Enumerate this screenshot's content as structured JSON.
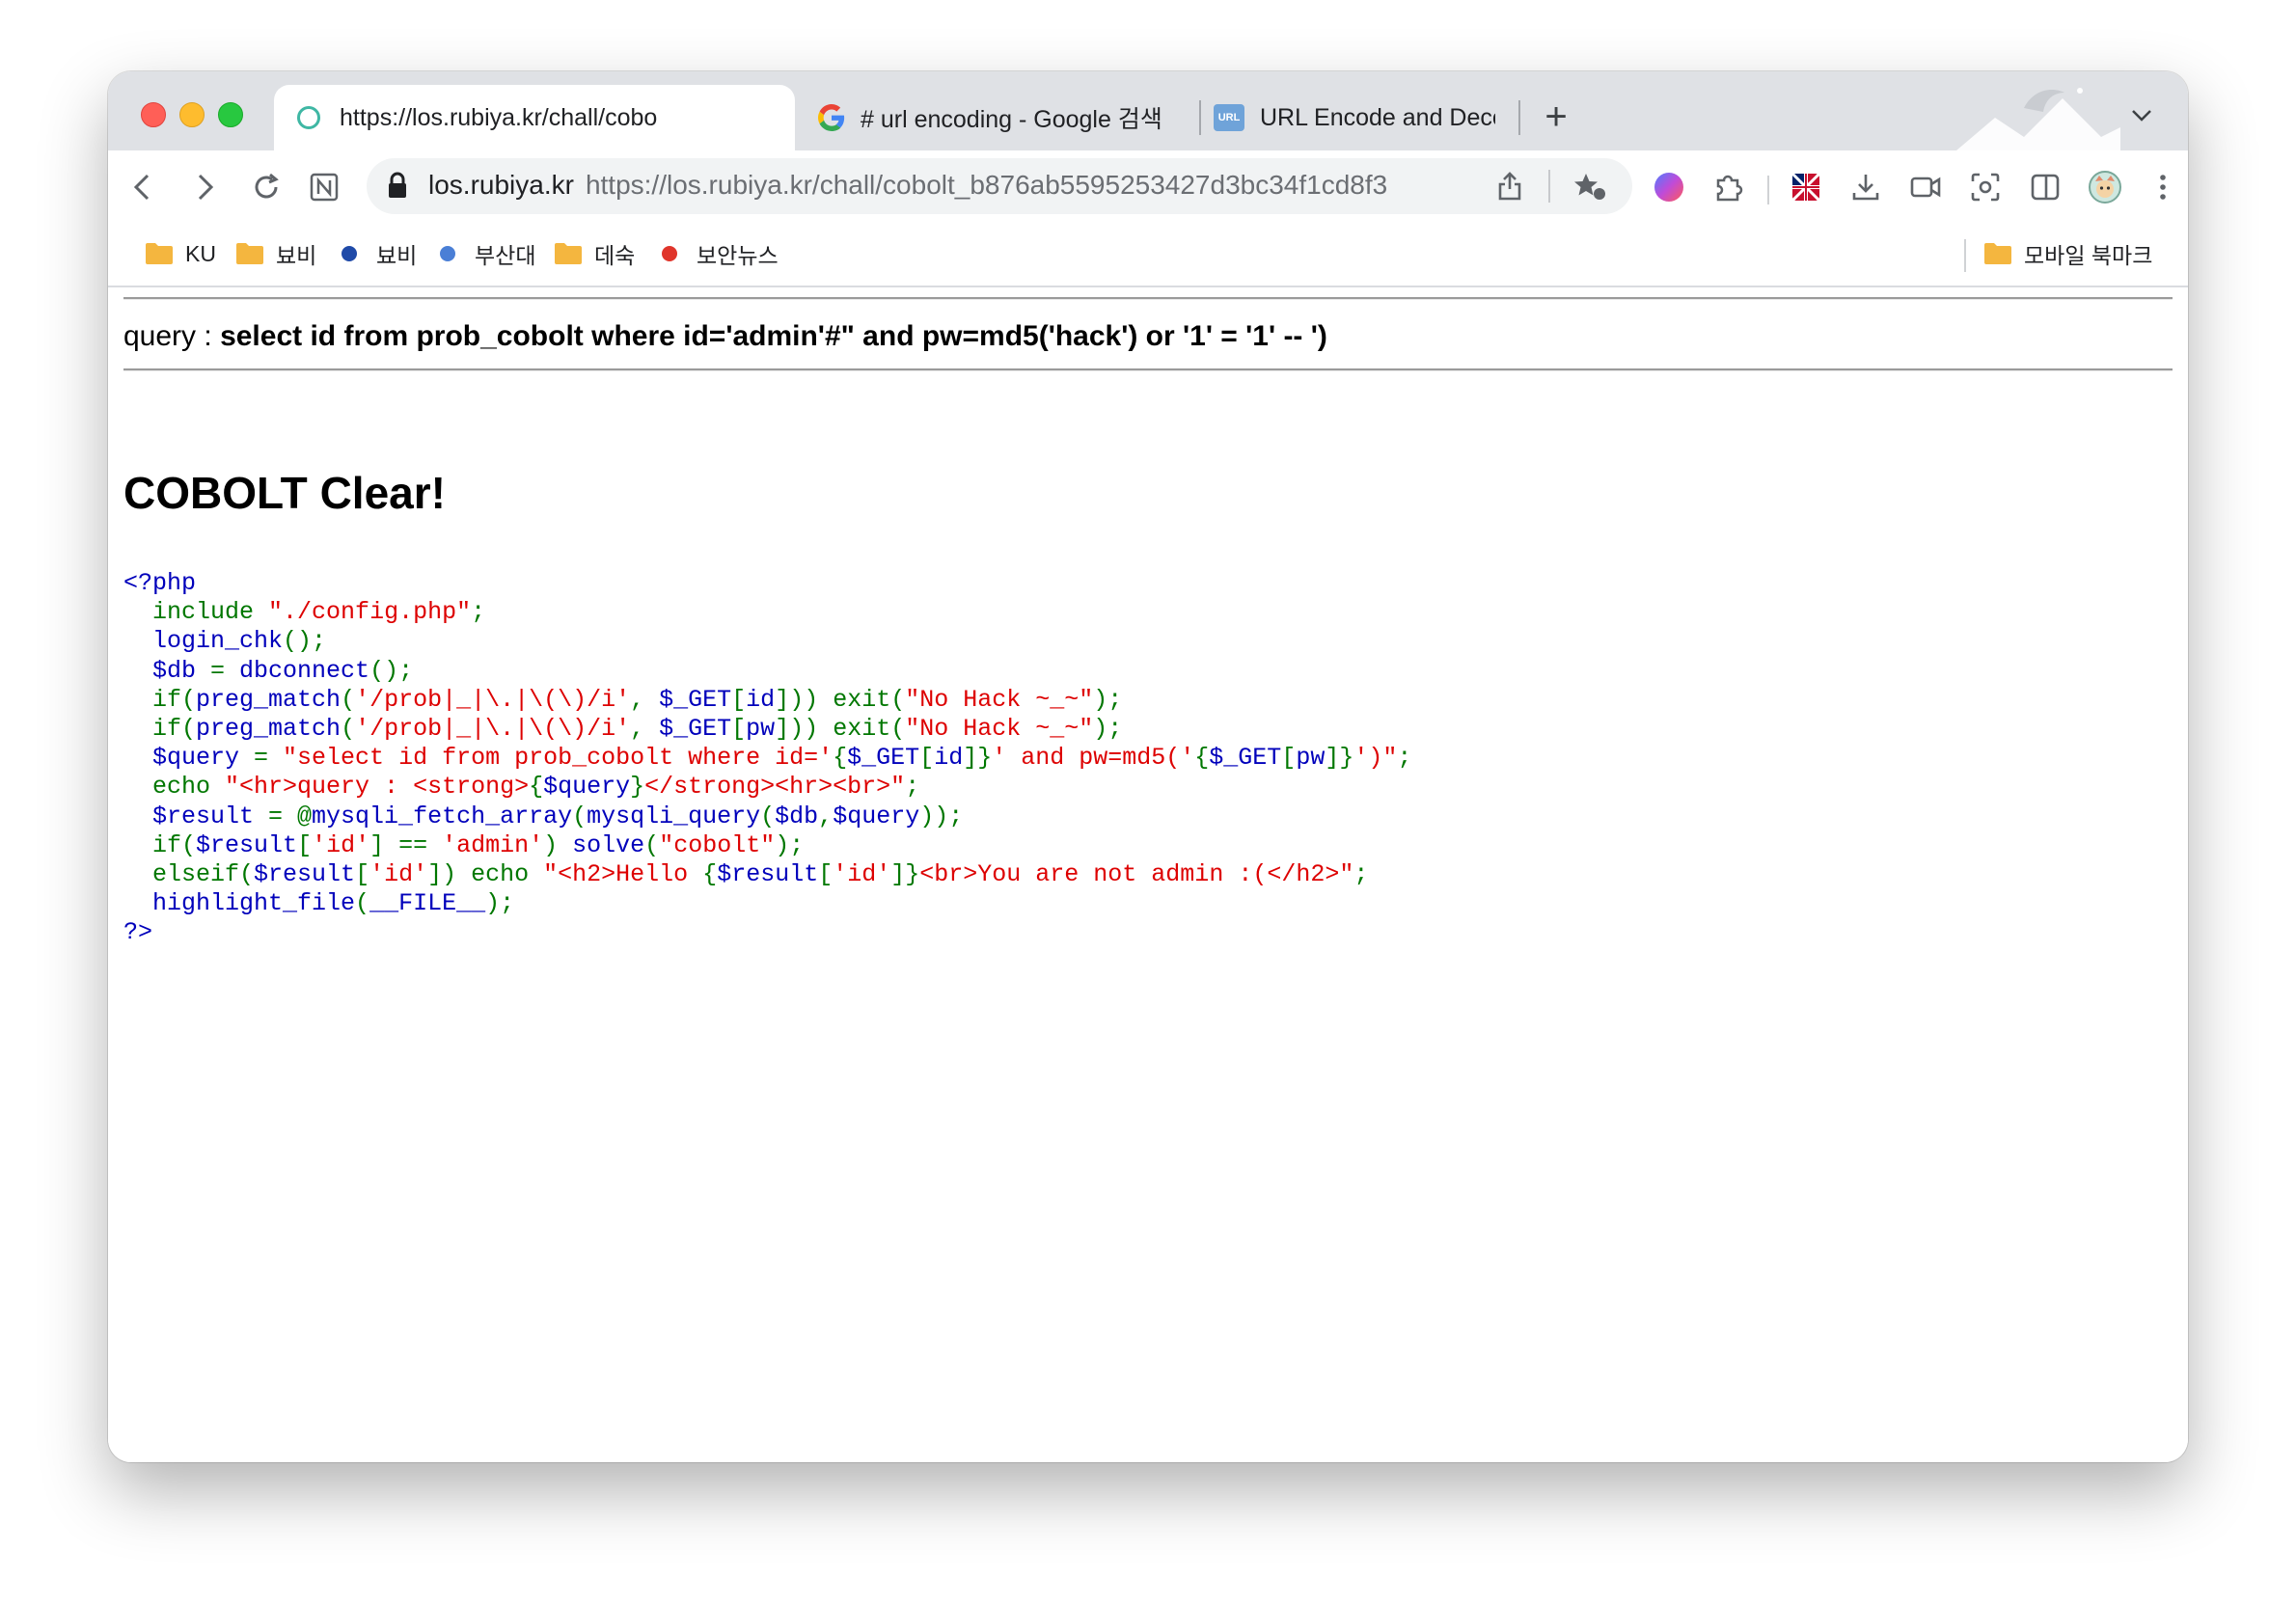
{
  "tabs": [
    {
      "title": "https://los.rubiya.kr/chall/cobo",
      "active": true,
      "icon": "loading-circle-icon"
    },
    {
      "title": "# url encoding - Google 검색",
      "active": false,
      "icon": "google-icon"
    },
    {
      "title": "URL Encode and Decode - Onl",
      "active": false,
      "icon": "url-icon"
    }
  ],
  "url_icon_text": "URL",
  "new_tab_label": "+",
  "address_bar": {
    "host": "los.rubiya.kr",
    "full_url": "https://los.rubiya.kr/chall/cobolt_b876ab5595253427d3bc34f1cd8f3"
  },
  "bookmarks": [
    {
      "label": "KU",
      "type": "folder"
    },
    {
      "label": "뵤비",
      "type": "folder"
    },
    {
      "label": "뵤비",
      "type": "dot",
      "color": "#1f4aa8"
    },
    {
      "label": "부산대",
      "type": "dot",
      "color": "#4a7fd6"
    },
    {
      "label": "데숙",
      "type": "folder"
    },
    {
      "label": "보안뉴스",
      "type": "dot",
      "color": "#e0352b"
    }
  ],
  "mobile_bookmarks": "모바일 북마크",
  "page": {
    "query_prefix": "query : ",
    "query": "select id from prob_cobolt where id='admin'#\" and pw=md5('hack') or '1' = '1' -- ')",
    "clear_heading": "COBOLT Clear!"
  },
  "code_lines": [
    [
      {
        "c": "v",
        "t": "<?php"
      }
    ],
    [
      {
        "c": "v",
        "t": "  "
      },
      {
        "c": "k",
        "t": "include "
      },
      {
        "c": "s",
        "t": "\"./config.php\""
      },
      {
        "c": "k",
        "t": ";"
      }
    ],
    [
      {
        "c": "v",
        "t": "  login_chk"
      },
      {
        "c": "k",
        "t": "();"
      }
    ],
    [
      {
        "c": "v",
        "t": "  $db "
      },
      {
        "c": "k",
        "t": "= "
      },
      {
        "c": "v",
        "t": "dbconnect"
      },
      {
        "c": "k",
        "t": "();"
      }
    ],
    [
      {
        "c": "v",
        "t": "  "
      },
      {
        "c": "k",
        "t": "if("
      },
      {
        "c": "v",
        "t": "preg_match"
      },
      {
        "c": "k",
        "t": "("
      },
      {
        "c": "s",
        "t": "'/prob|_|\\.|\\(\\)/i'"
      },
      {
        "c": "k",
        "t": ", "
      },
      {
        "c": "v",
        "t": "$_GET"
      },
      {
        "c": "k",
        "t": "["
      },
      {
        "c": "v",
        "t": "id"
      },
      {
        "c": "k",
        "t": "])) exit("
      },
      {
        "c": "s",
        "t": "\"No Hack ~_~\""
      },
      {
        "c": "k",
        "t": ");"
      }
    ],
    [
      {
        "c": "v",
        "t": "  "
      },
      {
        "c": "k",
        "t": "if("
      },
      {
        "c": "v",
        "t": "preg_match"
      },
      {
        "c": "k",
        "t": "("
      },
      {
        "c": "s",
        "t": "'/prob|_|\\.|\\(\\)/i'"
      },
      {
        "c": "k",
        "t": ", "
      },
      {
        "c": "v",
        "t": "$_GET"
      },
      {
        "c": "k",
        "t": "["
      },
      {
        "c": "v",
        "t": "pw"
      },
      {
        "c": "k",
        "t": "])) exit("
      },
      {
        "c": "s",
        "t": "\"No Hack ~_~\""
      },
      {
        "c": "k",
        "t": ");"
      }
    ],
    [
      {
        "c": "v",
        "t": "  $query "
      },
      {
        "c": "k",
        "t": "= "
      },
      {
        "c": "s",
        "t": "\"select id from prob_cobolt where id='"
      },
      {
        "c": "k",
        "t": "{"
      },
      {
        "c": "v",
        "t": "$_GET"
      },
      {
        "c": "k",
        "t": "["
      },
      {
        "c": "v",
        "t": "id"
      },
      {
        "c": "k",
        "t": "]}"
      },
      {
        "c": "s",
        "t": "' and pw=md5('"
      },
      {
        "c": "k",
        "t": "{"
      },
      {
        "c": "v",
        "t": "$_GET"
      },
      {
        "c": "k",
        "t": "["
      },
      {
        "c": "v",
        "t": "pw"
      },
      {
        "c": "k",
        "t": "]}"
      },
      {
        "c": "s",
        "t": "')\""
      },
      {
        "c": "k",
        "t": ";"
      }
    ],
    [
      {
        "c": "v",
        "t": "  "
      },
      {
        "c": "k",
        "t": "echo "
      },
      {
        "c": "s",
        "t": "\"<hr>query : <strong>"
      },
      {
        "c": "k",
        "t": "{"
      },
      {
        "c": "v",
        "t": "$query"
      },
      {
        "c": "k",
        "t": "}"
      },
      {
        "c": "s",
        "t": "</strong><hr><br>\""
      },
      {
        "c": "k",
        "t": ";"
      }
    ],
    [
      {
        "c": "v",
        "t": "  $result "
      },
      {
        "c": "k",
        "t": "= @"
      },
      {
        "c": "v",
        "t": "mysqli_fetch_array"
      },
      {
        "c": "k",
        "t": "("
      },
      {
        "c": "v",
        "t": "mysqli_query"
      },
      {
        "c": "k",
        "t": "("
      },
      {
        "c": "v",
        "t": "$db"
      },
      {
        "c": "k",
        "t": ","
      },
      {
        "c": "v",
        "t": "$query"
      },
      {
        "c": "k",
        "t": "));"
      }
    ],
    [
      {
        "c": "v",
        "t": "  "
      },
      {
        "c": "k",
        "t": "if("
      },
      {
        "c": "v",
        "t": "$result"
      },
      {
        "c": "k",
        "t": "["
      },
      {
        "c": "s",
        "t": "'id'"
      },
      {
        "c": "k",
        "t": "] == "
      },
      {
        "c": "s",
        "t": "'admin'"
      },
      {
        "c": "k",
        "t": ") "
      },
      {
        "c": "v",
        "t": "solve"
      },
      {
        "c": "k",
        "t": "("
      },
      {
        "c": "s",
        "t": "\"cobolt\""
      },
      {
        "c": "k",
        "t": ");"
      }
    ],
    [
      {
        "c": "v",
        "t": "  "
      },
      {
        "c": "k",
        "t": "elseif("
      },
      {
        "c": "v",
        "t": "$result"
      },
      {
        "c": "k",
        "t": "["
      },
      {
        "c": "s",
        "t": "'id'"
      },
      {
        "c": "k",
        "t": "]) echo "
      },
      {
        "c": "s",
        "t": "\"<h2>Hello "
      },
      {
        "c": "k",
        "t": "{"
      },
      {
        "c": "v",
        "t": "$result"
      },
      {
        "c": "k",
        "t": "["
      },
      {
        "c": "s",
        "t": "'id'"
      },
      {
        "c": "k",
        "t": "]}"
      },
      {
        "c": "s",
        "t": "<br>You are not admin :(</h2>\""
      },
      {
        "c": "k",
        "t": ";"
      }
    ],
    [
      {
        "c": "v",
        "t": "  highlight_file"
      },
      {
        "c": "k",
        "t": "("
      },
      {
        "c": "v",
        "t": "__FILE__"
      },
      {
        "c": "k",
        "t": ");"
      }
    ],
    [
      {
        "c": "v",
        "t": "?>"
      }
    ]
  ],
  "colors": {
    "php_default": "#0000bb",
    "php_keyword": "#007700",
    "php_string": "#dd0000",
    "tabstrip": "#dfe1e5"
  }
}
